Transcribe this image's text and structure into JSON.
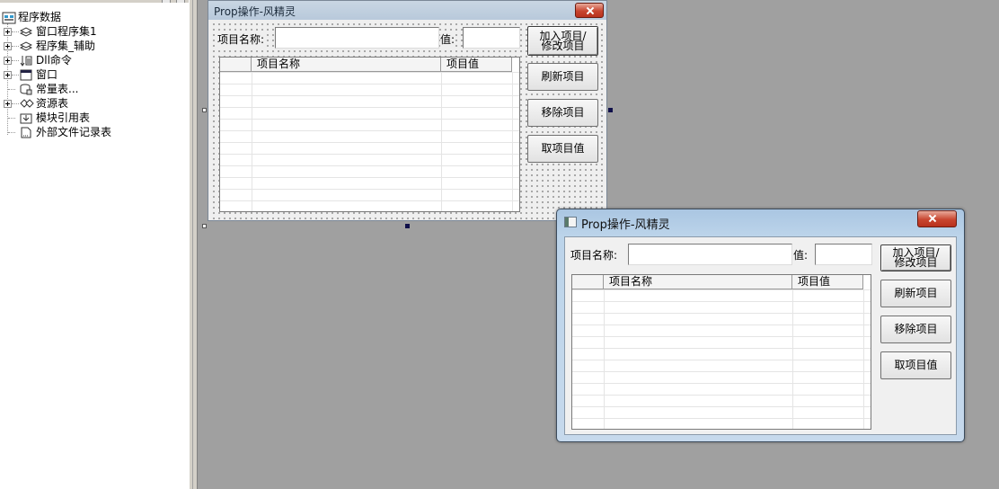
{
  "tree": {
    "root_label": "程序数据",
    "items": [
      {
        "label": "窗口程序集1",
        "icon": "stack-icon",
        "expandable": true
      },
      {
        "label": "程序集_辅助",
        "icon": "stack-icon",
        "expandable": true
      },
      {
        "label": "Dll命令",
        "icon": "dll-icon",
        "expandable": true
      },
      {
        "label": "窗口",
        "icon": "window-icon",
        "expandable": true
      },
      {
        "label": "常量表...",
        "icon": "constants-icon",
        "expandable": false
      },
      {
        "label": "资源表",
        "icon": "resources-icon",
        "expandable": true
      },
      {
        "label": "模块引用表",
        "icon": "module-icon",
        "expandable": false
      },
      {
        "label": "外部文件记录表",
        "icon": "file-icon",
        "expandable": false
      }
    ]
  },
  "form": {
    "title": "Prop操作-风精灵",
    "item_name_label": "项目名称:",
    "value_label": "值:",
    "columns": [
      "项目名称",
      "项目值"
    ],
    "buttons": {
      "add_line1": "加入项目/",
      "add_line2": "修改项目",
      "refresh": "刷新项目",
      "remove": "移除项目",
      "get_value": "取项目值"
    }
  },
  "colors": {
    "desktop": "#a0a0a0",
    "close_button": "#c8452f",
    "selection_handle": "#10104a"
  }
}
